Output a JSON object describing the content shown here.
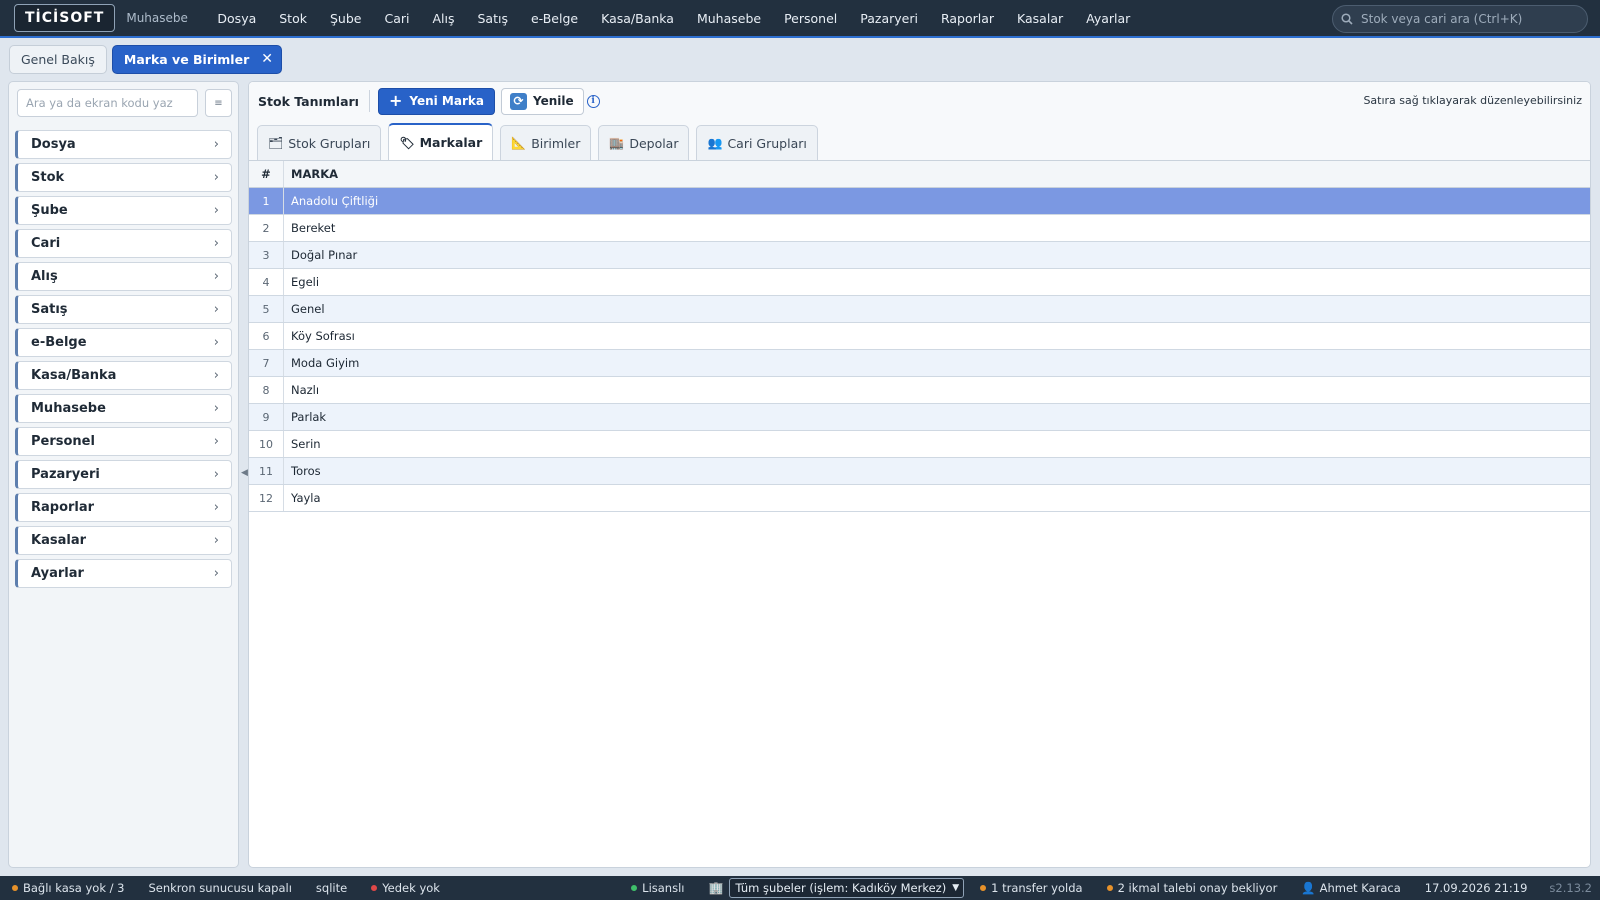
{
  "app": {
    "logo": "TİCİSOFT",
    "module": "Muhasebe"
  },
  "menu": [
    "Dosya",
    "Stok",
    "Şube",
    "Cari",
    "Alış",
    "Satış",
    "e-Belge",
    "Kasa/Banka",
    "Muhasebe",
    "Personel",
    "Pazaryeri",
    "Raporlar",
    "Kasalar",
    "Ayarlar"
  ],
  "search": {
    "placeholder": "Stok veya cari ara (Ctrl+K)"
  },
  "tabs": {
    "overview": "Genel Bakış",
    "active": "Marka ve Birimler"
  },
  "sidebar": {
    "search_placeholder": "Ara ya da ekran kodu yaz",
    "items": [
      "Dosya",
      "Stok",
      "Şube",
      "Cari",
      "Alış",
      "Satış",
      "e-Belge",
      "Kasa/Banka",
      "Muhasebe",
      "Personel",
      "Pazaryeri",
      "Raporlar",
      "Kasalar",
      "Ayarlar"
    ]
  },
  "toolbar": {
    "title": "Stok Tanımları",
    "new_label": "Yeni Marka",
    "refresh_label": "Yenile",
    "hint": "Satıra sağ tıklayarak düzenleyebilirsiniz"
  },
  "subtabs": [
    "Stok Grupları",
    "Markalar",
    "Birimler",
    "Depolar",
    "Cari Grupları"
  ],
  "grid": {
    "col_num": "#",
    "col_name": "MARKA",
    "rows": [
      {
        "n": "1",
        "name": "Anadolu Çiftliği"
      },
      {
        "n": "2",
        "name": "Bereket"
      },
      {
        "n": "3",
        "name": "Doğal Pınar"
      },
      {
        "n": "4",
        "name": "Egeli"
      },
      {
        "n": "5",
        "name": "Genel"
      },
      {
        "n": "6",
        "name": "Köy Sofrası"
      },
      {
        "n": "7",
        "name": "Moda Giyim"
      },
      {
        "n": "8",
        "name": "Nazlı"
      },
      {
        "n": "9",
        "name": "Parlak"
      },
      {
        "n": "10",
        "name": "Serin"
      },
      {
        "n": "11",
        "name": "Toros"
      },
      {
        "n": "12",
        "name": "Yayla"
      }
    ]
  },
  "status": {
    "kasa": "Bağlı kasa yok / 3",
    "sync": "Senkron sunucusu kapalı",
    "db": "sqlite",
    "backup": "Yedek yok",
    "license": "Lisanslı",
    "branch": "Tüm şubeler (işlem: Kadıköy Merkez)",
    "transfer": "1 transfer yolda",
    "approval": "2 ikmal talebi onay bekliyor",
    "user": "Ahmet Karaca",
    "datetime": "17.09.2026 21:19",
    "version": "s2.13.2"
  },
  "colors": {
    "accent": "#2862c8",
    "topbar": "#22303f",
    "selected_row": "#7b98e2",
    "dot_orange": "#e8922a",
    "dot_red": "#e04848",
    "dot_green": "#3fbf6a"
  },
  "icons": {
    "search": "search-icon",
    "refresh": "refresh-icon",
    "info": "info-icon",
    "user": "user-icon",
    "branch": "building-icon"
  }
}
